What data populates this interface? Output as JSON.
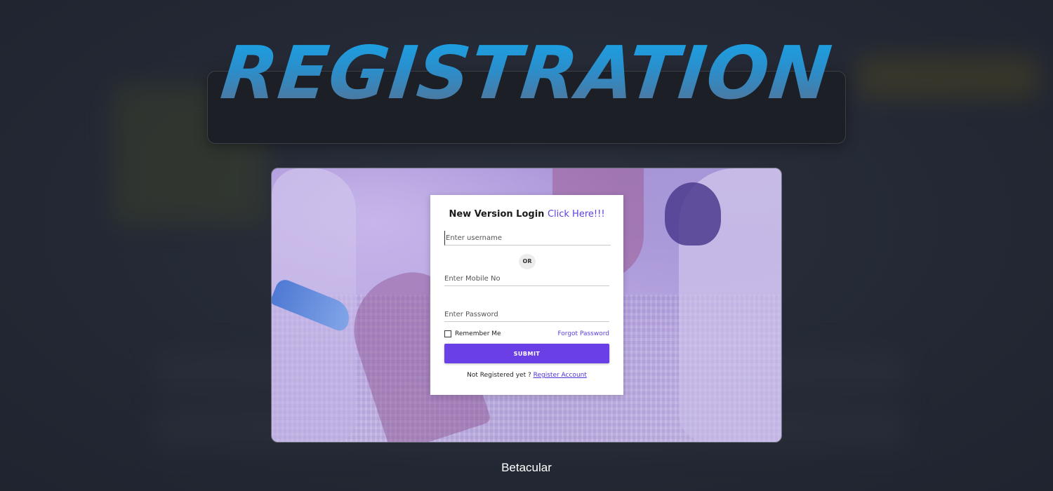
{
  "headline": "REGISTRATION",
  "login": {
    "title_text": "New Version Login",
    "title_link": "Click Here!!!",
    "username_placeholder": "Enter username",
    "or_label": "OR",
    "mobile_placeholder": "Enter Mobile No",
    "password_placeholder": "Enter Password",
    "remember_label": "Remember Me",
    "forgot_label": "Forgot Password",
    "submit_label": "SUBMIT",
    "not_registered_text": "Not Registered yet ?",
    "register_link": "Register Account"
  },
  "caption": "Betacular",
  "colors": {
    "page_background": "#232834",
    "headline_blue": "#1fa0dd",
    "submit_purple": "#6a3fe6",
    "link_purple": "#5b3fe0",
    "hero_lavender": "#b6a3e0"
  },
  "icons": {
    "checkbox": "checkbox-icon"
  }
}
